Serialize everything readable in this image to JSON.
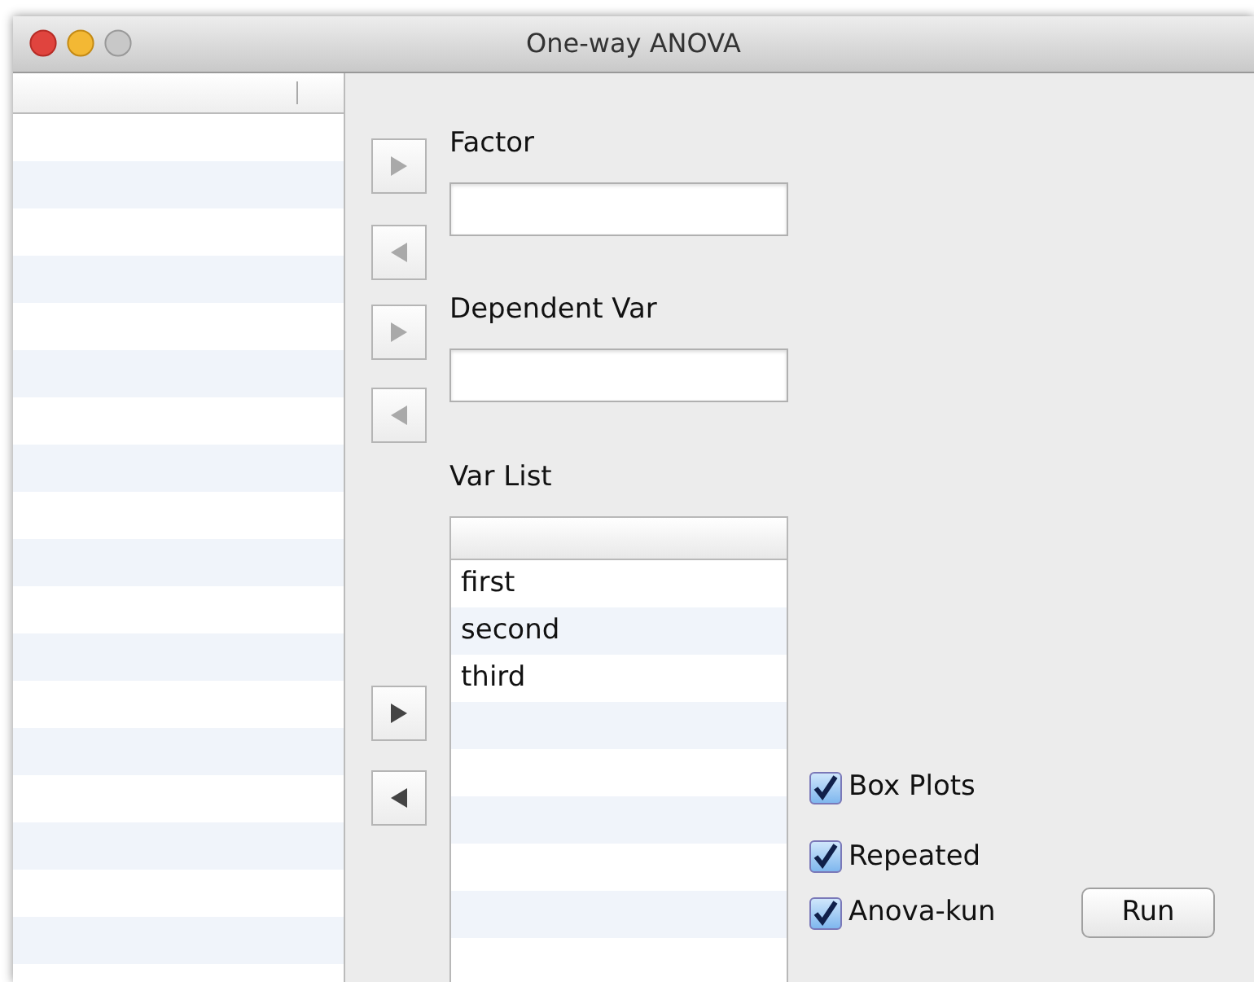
{
  "window": {
    "title": "One-way ANOVA"
  },
  "transfer_buttons": [
    {
      "kind": "right",
      "disabled": true
    },
    {
      "kind": "left",
      "disabled": true
    },
    {
      "kind": "right",
      "disabled": true
    },
    {
      "kind": "left",
      "disabled": true
    },
    {
      "kind": "right",
      "disabled": false
    },
    {
      "kind": "left",
      "disabled": false
    }
  ],
  "factor": {
    "label": "Factor"
  },
  "dependent_var": {
    "label": "Dependent Var"
  },
  "var_list": {
    "label": "Var List",
    "items": [
      "first",
      "second",
      "third"
    ]
  },
  "options": [
    {
      "label": "Box Plots",
      "checked": true
    },
    {
      "label": "Repeated",
      "checked": true
    },
    {
      "label": "Anova-kun",
      "checked": true
    }
  ],
  "run_button": {
    "label": "Run"
  }
}
